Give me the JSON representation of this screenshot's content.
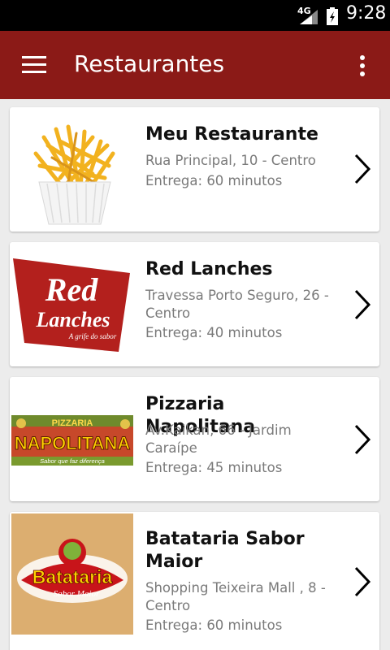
{
  "status_bar": {
    "network": "4G",
    "time": "9:28",
    "icons": [
      "signal-icon",
      "battery-icon"
    ]
  },
  "app_bar": {
    "title": "Restaurantes",
    "color": "#8b1a17",
    "icons": [
      "menu-icon",
      "overflow-menu-icon"
    ]
  },
  "restaurants": [
    {
      "name": "Meu Restaurante",
      "address": "Rua Principal, 10 - Centro",
      "delivery": "Entrega: 60 minutos",
      "image": "french-fries-photo"
    },
    {
      "name": "Red Lanches",
      "address": "Travessa Porto Seguro, 26 - Centro",
      "delivery": "Entrega: 40 minutos",
      "image": "red-lanches-logo",
      "logo_text": [
        "Red",
        "Lanches",
        "A grife do sabor"
      ]
    },
    {
      "name": "Pizzaria Napolitana",
      "address": "Av.Kaikan, 66 - Jardim Caraípe",
      "delivery": "Entrega: 45 minutos",
      "image": "pizzaria-napolitana-logo",
      "logo_text": [
        "PIZZARIA",
        "NAPOLITANA",
        "Sabor que faz diferença"
      ]
    },
    {
      "name": "Batataria Sabor Maior",
      "address": "Shopping Teixeira Mall , 8 - Centro",
      "delivery": "Entrega: 60 minutos",
      "image": "batataria-logo",
      "logo_text": [
        "Batataria",
        "Sabor Maior"
      ]
    }
  ]
}
